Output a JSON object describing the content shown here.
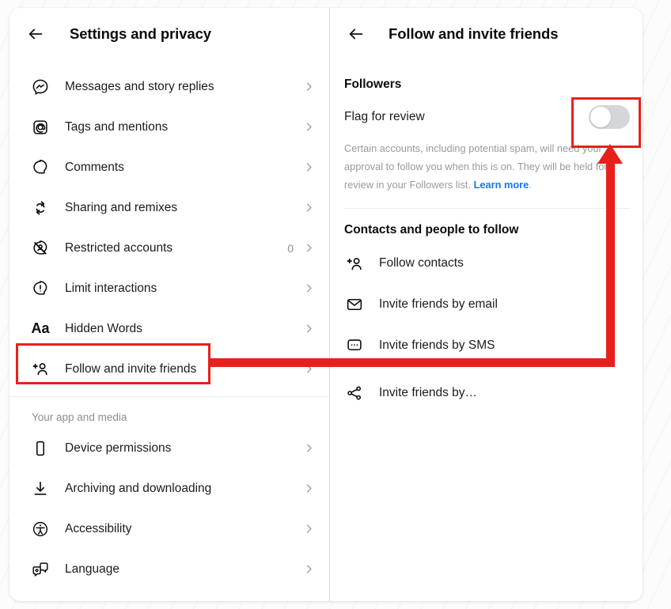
{
  "left_panel": {
    "back_icon": "back-arrow-icon",
    "title": "Settings and privacy",
    "items": [
      {
        "icon": "messenger-icon",
        "label": "Messages and story replies",
        "count": "",
        "chevron": "›"
      },
      {
        "icon": "at-mention-icon",
        "label": "Tags and mentions",
        "count": "",
        "chevron": "›"
      },
      {
        "icon": "comment-bubble-icon",
        "label": "Comments",
        "count": "",
        "chevron": "›"
      },
      {
        "icon": "remix-arrows-icon",
        "label": "Sharing and remixes",
        "count": "",
        "chevron": "›"
      },
      {
        "icon": "restricted-user-icon",
        "label": "Restricted accounts",
        "count": "0",
        "chevron": "›"
      },
      {
        "icon": "exclamation-bubble-icon",
        "label": "Limit interactions",
        "count": "",
        "chevron": "›"
      },
      {
        "icon": "text-size-icon",
        "label": "Hidden Words",
        "count": "",
        "chevron": "›"
      },
      {
        "icon": "add-person-icon",
        "label": "Follow and invite friends",
        "count": "",
        "chevron": "›"
      }
    ],
    "section_label": "Your app and media",
    "section_items": [
      {
        "icon": "phone-icon",
        "label": "Device permissions",
        "count": "",
        "chevron": "›"
      },
      {
        "icon": "download-icon",
        "label": "Archiving and downloading",
        "count": "",
        "chevron": "›"
      },
      {
        "icon": "accessibility-icon",
        "label": "Accessibility",
        "count": "",
        "chevron": "›"
      },
      {
        "icon": "language-icon",
        "label": "Language",
        "count": "",
        "chevron": "›"
      }
    ]
  },
  "right_panel": {
    "back_icon": "back-arrow-icon",
    "title": "Follow and invite friends",
    "followers_heading": "Followers",
    "flag_row": {
      "label": "Flag for review",
      "toggle_state": "off"
    },
    "description": {
      "text": "Certain accounts, including potential spam, will need your approval to follow you when this is on. They will be held for review in your Followers list. ",
      "link": "Learn more",
      "tail": "."
    },
    "contacts_heading": "Contacts and people to follow",
    "contact_items": [
      {
        "icon": "add-person-icon",
        "label": "Follow contacts"
      },
      {
        "icon": "envelope-icon",
        "label": "Invite friends by email"
      },
      {
        "icon": "sms-bubble-icon",
        "label": "Invite friends by SMS"
      },
      {
        "icon": "share-nodes-icon",
        "label": "Invite friends by…"
      }
    ]
  },
  "annotations": {
    "highlight_color": "#e8201b",
    "boxes": [
      {
        "name": "follow-and-invite-friends-highlight"
      },
      {
        "name": "flag-for-review-toggle-highlight"
      }
    ],
    "arrow": {
      "name": "annotation-arrow",
      "direction": "up"
    }
  }
}
